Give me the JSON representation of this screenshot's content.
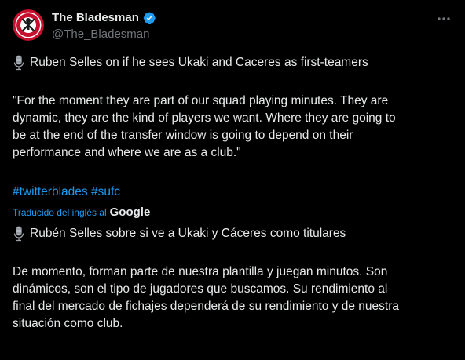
{
  "author": {
    "name": "The Bladesman",
    "handle": "@The_Bladesman",
    "avatar_icon": "sheffield-united-crest-icon",
    "verified_icon": "verified-badge-icon",
    "accent_color": "#1d9bf0"
  },
  "menu": {
    "more_icon": "more-dots-icon"
  },
  "tweet": {
    "headline": "Ruben Selles on if he sees Ukaki and Caceres as first-teamers",
    "quote_lines": [
      "\"For the moment they are part of our squad playing minutes. They are",
      "dynamic, they are the kind of players we want. Where they are going to",
      "be at the end of the transfer window is going to depend on their",
      "performance and where we are as a club.\""
    ],
    "hashtags": [
      "#twitterblades",
      "#sufc"
    ]
  },
  "translation": {
    "label": "Traducido del inglés al",
    "provider": "Google",
    "headline": "Rubén Selles sobre si ve a Ukaki y Cáceres como titulares",
    "body_lines": [
      "De momento, forman parte de nuestra plantilla y juegan minutos. Son",
      "dinámicos, son el tipo de jugadores que buscamos. Su rendimiento al",
      "final del mercado de fichajes dependerá de su rendimiento y de nuestra",
      "situación como club."
    ]
  }
}
